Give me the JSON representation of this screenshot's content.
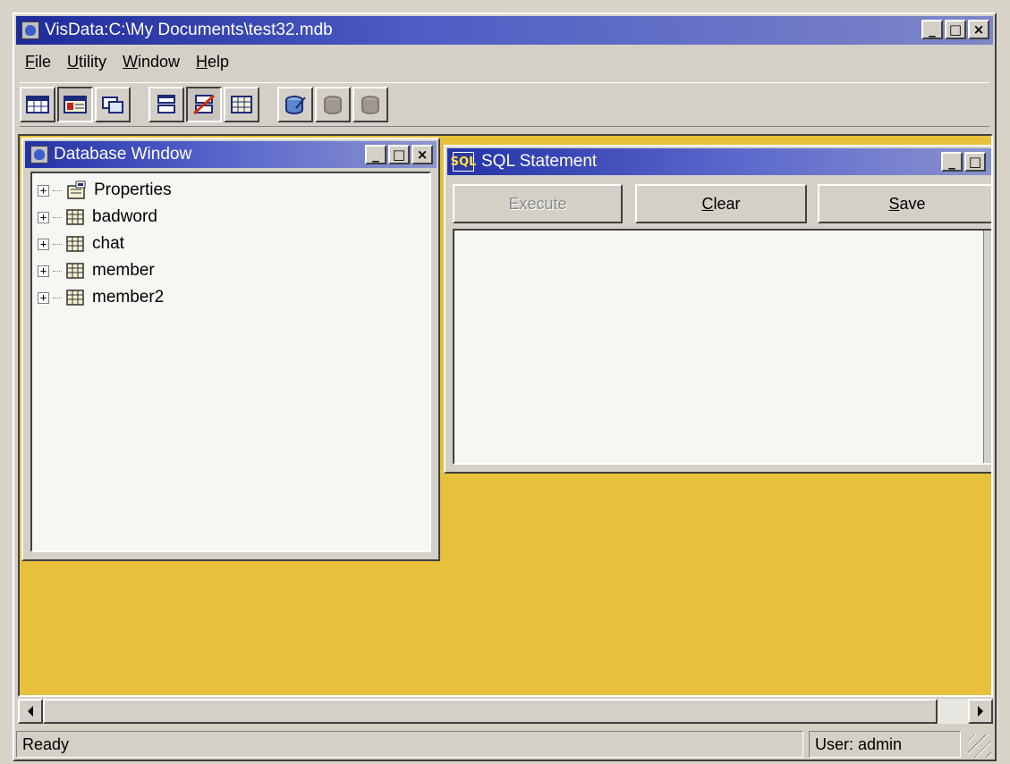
{
  "window": {
    "title": "VisData:C:\\My Documents\\test32.mdb"
  },
  "menu": {
    "items": [
      {
        "label_first": "F",
        "label_rest": "ile"
      },
      {
        "label_first": "U",
        "label_rest": "tility"
      },
      {
        "label_first": "W",
        "label_rest": "indow"
      },
      {
        "label_first": "H",
        "label_rest": "elp"
      }
    ]
  },
  "toolbar": {
    "icons": [
      "table-icon",
      "dynaset-icon",
      "snapshot-icon",
      "data-control-icon",
      "no-data-control-icon",
      "dbgrid-icon",
      "begin-transaction-icon",
      "commit-icon",
      "rollback-icon"
    ]
  },
  "database_window": {
    "title": "Database Window",
    "tree": [
      {
        "label": "Properties",
        "icon": "properties-icon"
      },
      {
        "label": "badword",
        "icon": "table-icon"
      },
      {
        "label": "chat",
        "icon": "table-icon"
      },
      {
        "label": "member",
        "icon": "table-icon"
      },
      {
        "label": "member2",
        "icon": "table-icon"
      }
    ]
  },
  "sql_window": {
    "title": "SQL Statement",
    "icon_label": "SQL",
    "execute": {
      "label": "Execute",
      "enabled": false
    },
    "clear": {
      "label_first": "C",
      "label_rest": "lear"
    },
    "save": {
      "label_first": "S",
      "label_rest": "ave"
    },
    "query_text": ""
  },
  "status": {
    "message": "Ready",
    "user": "User: admin"
  },
  "colors": {
    "mdi_background": "#e8c13c",
    "title_active": "#1f2a9a"
  }
}
